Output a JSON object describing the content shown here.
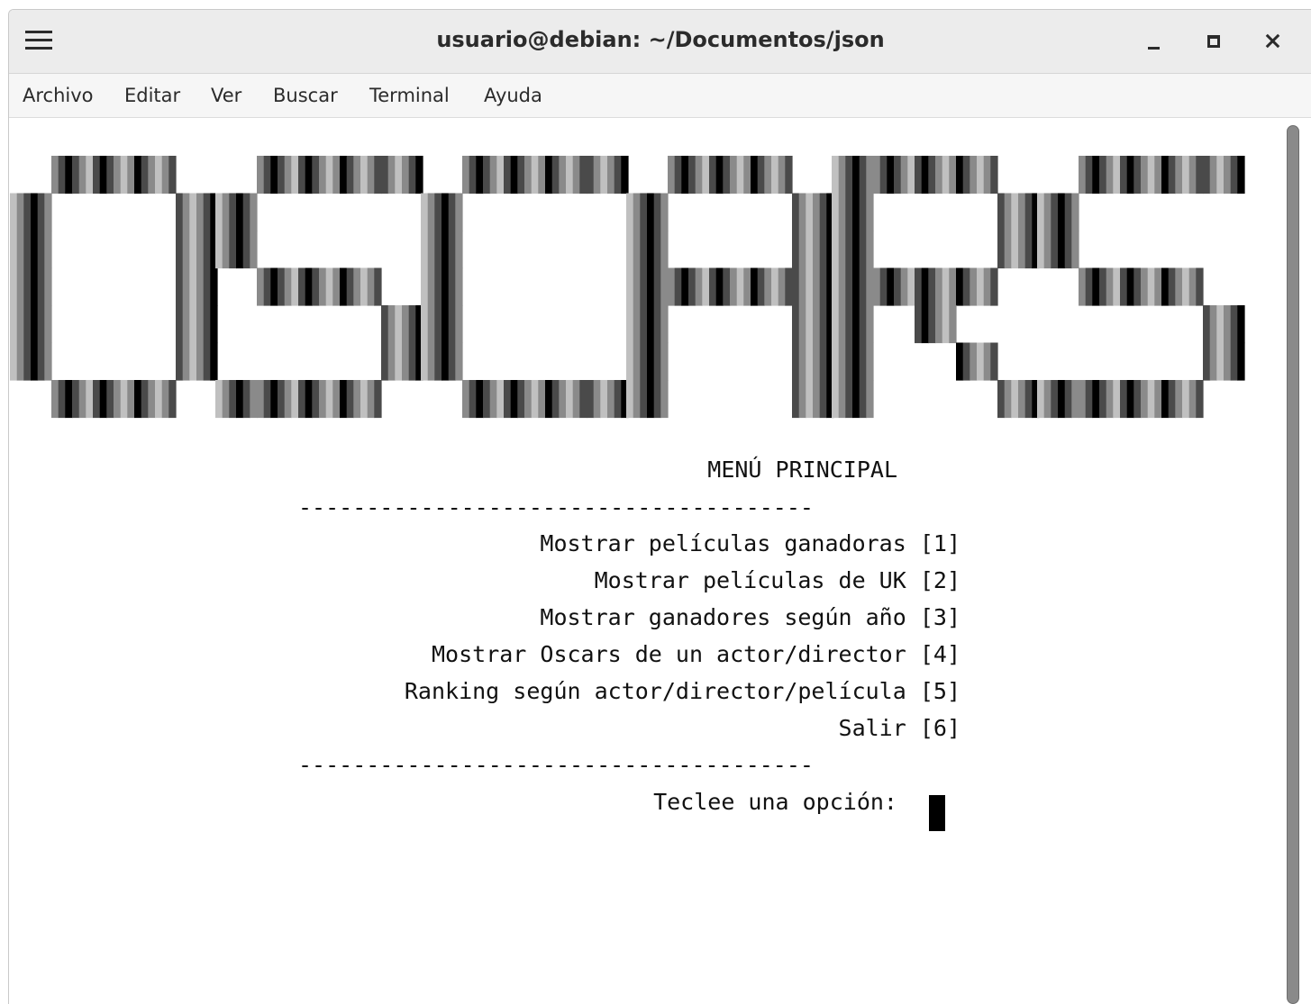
{
  "window": {
    "title": "usuario@debian: ~/Documentos/json"
  },
  "menubar": {
    "items": [
      "Archivo",
      "Editar",
      "Ver",
      "Buscar",
      "Terminal",
      "Ayuda"
    ]
  },
  "terminal": {
    "banner_text": "OSCARS",
    "menu_title": "MENÚ PRINCIPAL",
    "separator": "--------------------------------------",
    "options": [
      {
        "label": "Mostrar películas ganadoras",
        "key": "[1]"
      },
      {
        "label": "Mostrar películas de UK",
        "key": "[2]"
      },
      {
        "label": "Mostrar ganadores según año",
        "key": "[3]"
      },
      {
        "label": "Mostrar Oscars de un actor/director",
        "key": "[4]"
      },
      {
        "label": "Ranking según actor/director/película",
        "key": "[5]"
      },
      {
        "label": "Salir",
        "key": "[6]"
      }
    ],
    "prompt": "Teclee una opción:"
  },
  "colors": {
    "titlebar": "#ececec",
    "menubar": "#f6f6f6",
    "text": "#2b2b2b",
    "terminal_bg": "#ffffff",
    "terminal_fg": "#111111"
  },
  "icons": {
    "menu": "hamburger-menu-icon",
    "minimize": "minimize-icon",
    "maximize": "maximize-icon",
    "close": "close-icon"
  }
}
